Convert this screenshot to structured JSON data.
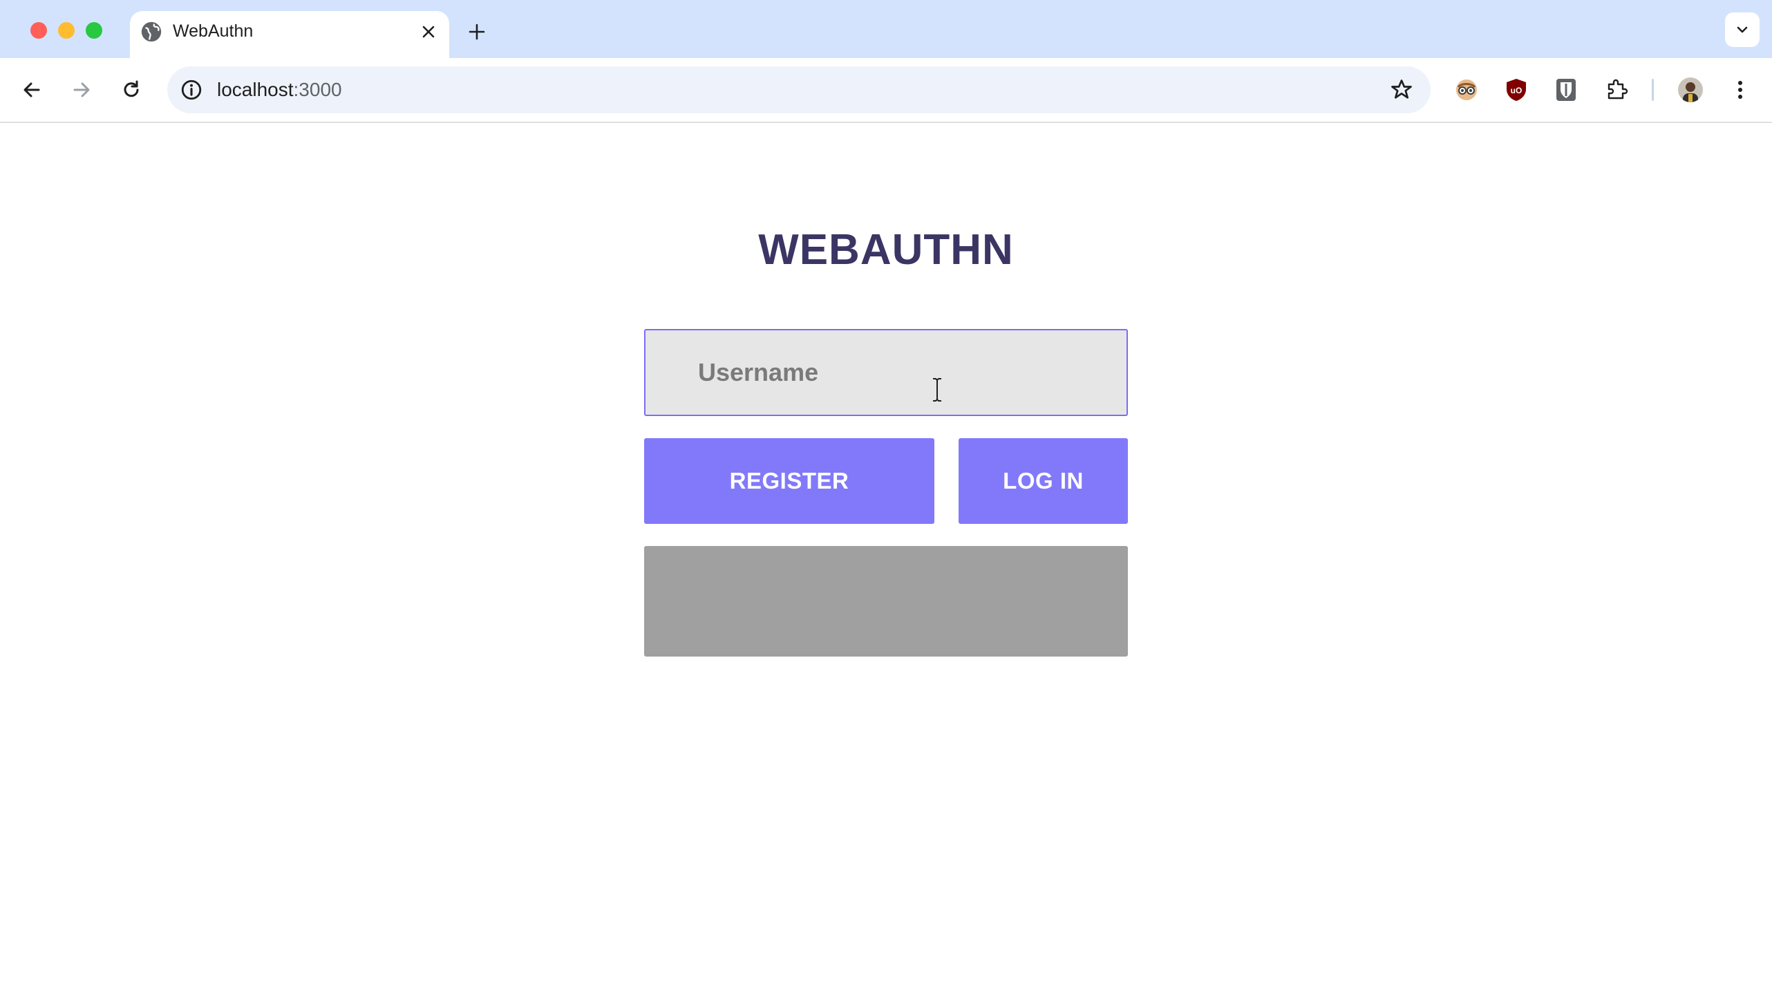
{
  "browser": {
    "tab": {
      "title": "WebAuthn",
      "favicon": "globe-icon"
    },
    "address_bar": {
      "host": "localhost",
      "port": ":3000"
    },
    "extensions": [
      "reader-extension-icon",
      "ublock-shield-icon",
      "bitwarden-shield-icon",
      "puzzle-piece-icon"
    ],
    "colors": {
      "tabstrip": "#d3e3fd",
      "omnibox": "#eef3fb"
    }
  },
  "page": {
    "title": "WEBAUTHN",
    "username": {
      "placeholder": "Username",
      "value": ""
    },
    "buttons": {
      "register": "REGISTER",
      "login": "LOG IN"
    },
    "colors": {
      "title": "#3a3563",
      "button": "#8279fa",
      "input_bg": "#e6e6e6",
      "status_box": "#a0a0a0"
    }
  }
}
